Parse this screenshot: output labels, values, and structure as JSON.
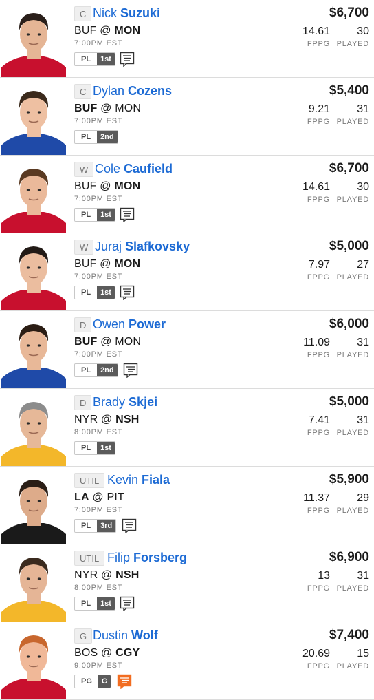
{
  "colors": {
    "accent": "#1c6ad4",
    "note_highlight": "#f26d21",
    "tag_dark": "#5b5b5b"
  },
  "labels": {
    "fppg": "FPPG",
    "played": "PLAYED"
  },
  "players": [
    {
      "pos": "C",
      "first": "Nick",
      "last": "Suzuki",
      "away": "BUF",
      "home": "MON",
      "bold_team": "home",
      "time": "7:00PM EST",
      "tag_a": "PL",
      "tag_b": "1st",
      "note": true,
      "note_highlight": false,
      "salary": "$6,700",
      "fppg": "14.61",
      "played": "30",
      "jersey": "#c8102e",
      "skin": "#e5b595",
      "hair": "#2a1f1a"
    },
    {
      "pos": "C",
      "first": "Dylan",
      "last": "Cozens",
      "away": "BUF",
      "home": "MON",
      "bold_team": "away",
      "time": "7:00PM EST",
      "tag_a": "PL",
      "tag_b": "2nd",
      "note": false,
      "note_highlight": false,
      "salary": "$5,400",
      "fppg": "9.21",
      "played": "31",
      "jersey": "#1f4aa8",
      "skin": "#eec0a2",
      "hair": "#3b2a1c"
    },
    {
      "pos": "W",
      "first": "Cole",
      "last": "Caufield",
      "away": "BUF",
      "home": "MON",
      "bold_team": "home",
      "time": "7:00PM EST",
      "tag_a": "PL",
      "tag_b": "1st",
      "note": true,
      "note_highlight": false,
      "salary": "$6,700",
      "fppg": "14.61",
      "played": "30",
      "jersey": "#c8102e",
      "skin": "#eab99a",
      "hair": "#5a3a22"
    },
    {
      "pos": "W",
      "first": "Juraj",
      "last": "Slafkovsky",
      "away": "BUF",
      "home": "MON",
      "bold_team": "home",
      "time": "7:00PM EST",
      "tag_a": "PL",
      "tag_b": "1st",
      "note": true,
      "note_highlight": false,
      "salary": "$5,000",
      "fppg": "7.97",
      "played": "27",
      "jersey": "#c8102e",
      "skin": "#ebbd9f",
      "hair": "#221a16"
    },
    {
      "pos": "D",
      "first": "Owen",
      "last": "Power",
      "away": "BUF",
      "home": "MON",
      "bold_team": "away",
      "time": "7:00PM EST",
      "tag_a": "PL",
      "tag_b": "2nd",
      "note": true,
      "note_highlight": false,
      "salary": "$6,000",
      "fppg": "11.09",
      "played": "31",
      "jersey": "#1f4aa8",
      "skin": "#e8b898",
      "hair": "#2b1d14"
    },
    {
      "pos": "D",
      "first": "Brady",
      "last": "Skjei",
      "away": "NYR",
      "home": "NSH",
      "bold_team": "home",
      "time": "8:00PM EST",
      "tag_a": "PL",
      "tag_b": "1st",
      "note": false,
      "note_highlight": false,
      "salary": "$5,000",
      "fppg": "7.41",
      "played": "31",
      "jersey": "#f3b72a",
      "skin": "#e6b898",
      "hair": "#8c8c8c"
    },
    {
      "pos": "UTIL",
      "first": "Kevin",
      "last": "Fiala",
      "away": "LA",
      "home": "PIT",
      "bold_team": "away",
      "time": "7:00PM EST",
      "tag_a": "PL",
      "tag_b": "3rd",
      "note": true,
      "note_highlight": false,
      "salary": "$5,900",
      "fppg": "11.37",
      "played": "29",
      "jersey": "#1a1a1a",
      "skin": "#ddab8a",
      "hair": "#2a1e16"
    },
    {
      "pos": "UTIL",
      "first": "Filip",
      "last": "Forsberg",
      "away": "NYR",
      "home": "NSH",
      "bold_team": "home",
      "time": "8:00PM EST",
      "tag_a": "PL",
      "tag_b": "1st",
      "note": true,
      "note_highlight": false,
      "salary": "$6,900",
      "fppg": "13",
      "played": "31",
      "jersey": "#f3b72a",
      "skin": "#e5b596",
      "hair": "#3a2a1e"
    },
    {
      "pos": "G",
      "first": "Dustin",
      "last": "Wolf",
      "away": "BOS",
      "home": "CGY",
      "bold_team": "home",
      "time": "9:00PM EST",
      "tag_a": "PG",
      "tag_b": "G",
      "note": true,
      "note_highlight": true,
      "salary": "$7,400",
      "fppg": "20.69",
      "played": "15",
      "jersey": "#c8102e",
      "skin": "#f0b898",
      "hair": "#c8672e"
    }
  ]
}
